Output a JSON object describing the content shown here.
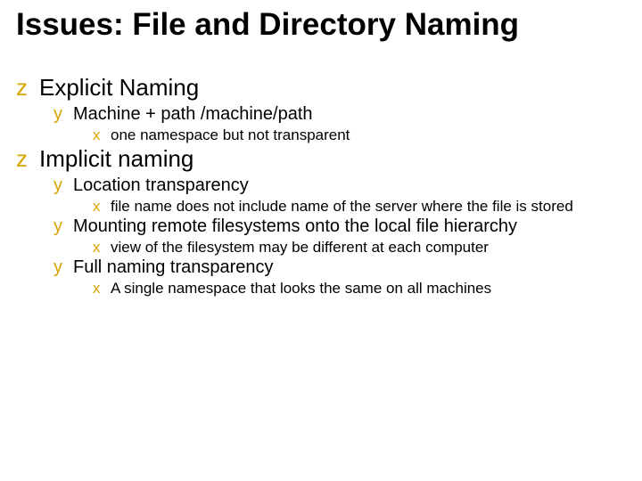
{
  "title": "Issues: File and Directory Naming",
  "items": [
    {
      "lvl": 1,
      "bullet": "z",
      "text": "Explicit Naming"
    },
    {
      "lvl": 2,
      "bullet": "y",
      "text": "Machine + path  /machine/path"
    },
    {
      "lvl": 3,
      "bullet": "x",
      "text": "one namespace but not transparent"
    },
    {
      "lvl": 1,
      "bullet": "z",
      "text": "Implicit naming"
    },
    {
      "lvl": 2,
      "bullet": "y",
      "text": "Location transparency"
    },
    {
      "lvl": 3,
      "bullet": "x",
      "text": "file name does not include name of the server where the file is stored"
    },
    {
      "lvl": 2,
      "bullet": "y",
      "text": "Mounting remote filesystems onto the local file hierarchy"
    },
    {
      "lvl": 3,
      "bullet": "x",
      "text": "view of the filesystem may be different at each computer"
    },
    {
      "lvl": 2,
      "bullet": "y",
      "text": "Full naming transparency"
    },
    {
      "lvl": 3,
      "bullet": "x",
      "text": "A single namespace that looks the same on all machines"
    }
  ]
}
